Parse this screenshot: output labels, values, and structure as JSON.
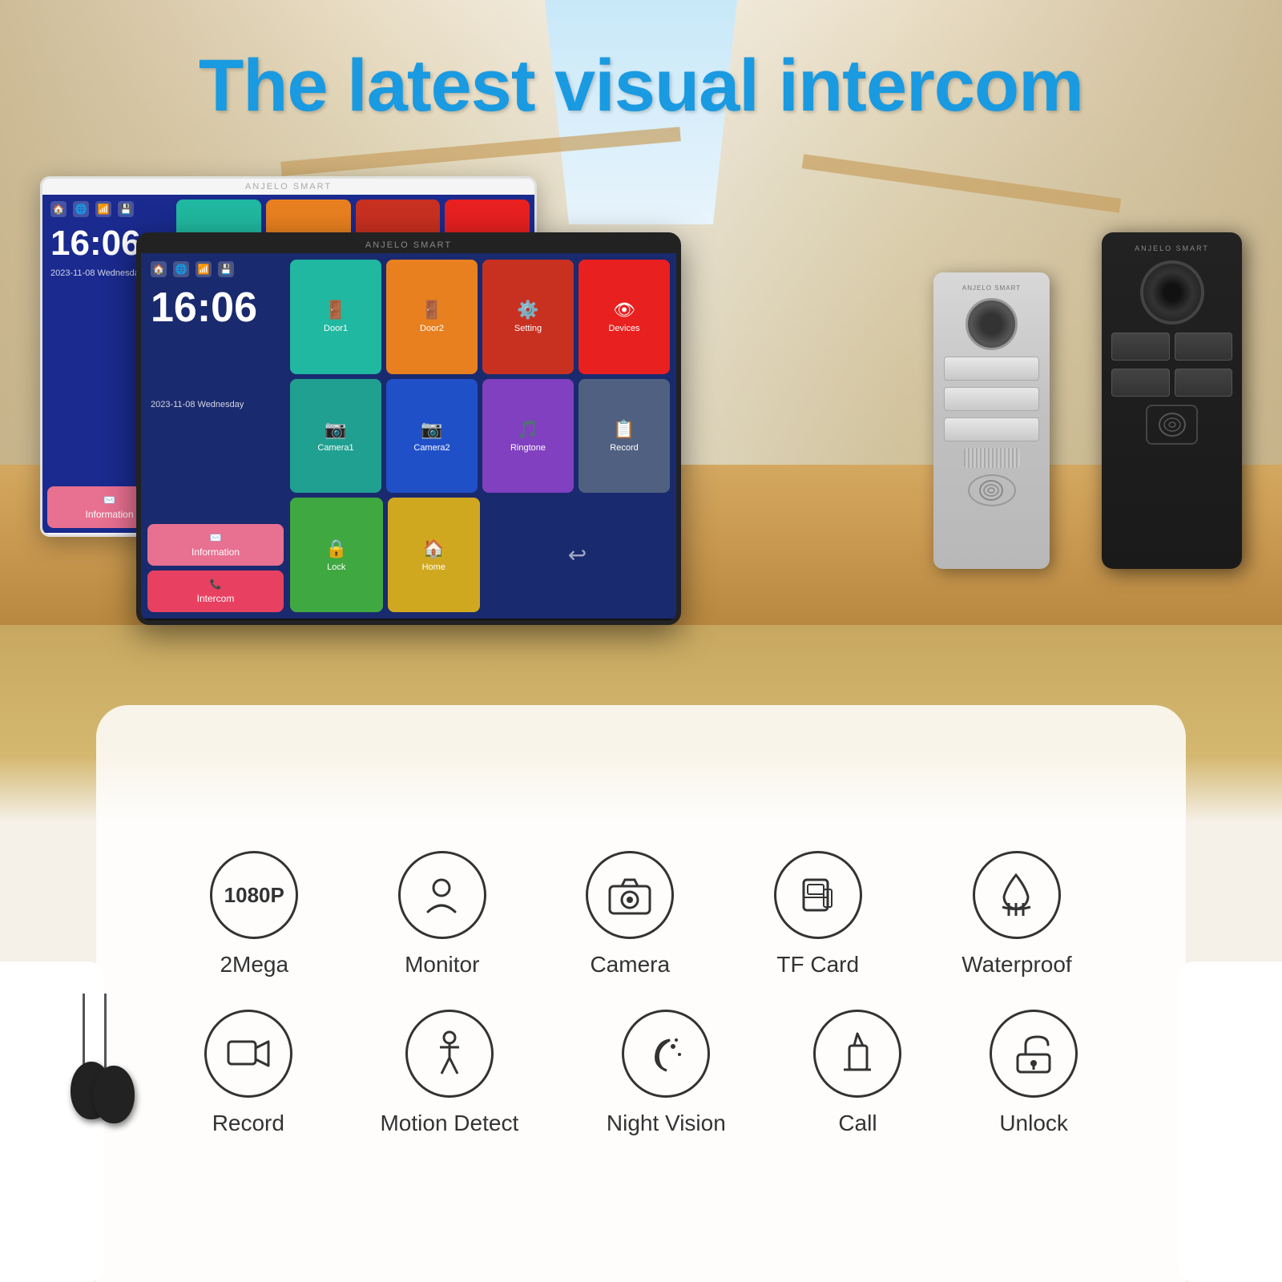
{
  "title": "The latest visual intercom",
  "monitor": {
    "brand": "ANJELO SMART",
    "clock": "16:06",
    "date": "2023-11-08 Wednesday",
    "tiles": [
      {
        "label": "Door1",
        "color": "teal",
        "icon": "🚪"
      },
      {
        "label": "Door2",
        "color": "orange",
        "icon": "🚪"
      },
      {
        "label": "Setting",
        "color": "red-dark",
        "icon": "⚙️"
      },
      {
        "label": "Devices",
        "color": "red-vivid",
        "icon": "👁"
      },
      {
        "label": "Camera1",
        "color": "teal2",
        "icon": "📷"
      },
      {
        "label": "Camera2",
        "color": "blue",
        "icon": "📷"
      },
      {
        "label": "Ringtone",
        "color": "purple",
        "icon": "🎵"
      },
      {
        "label": "Record",
        "color": "gray",
        "icon": "📋"
      },
      {
        "label": "Lock",
        "color": "green",
        "icon": "🔒"
      },
      {
        "label": "Home",
        "color": "yellow",
        "icon": "🏠"
      }
    ],
    "left_tiles": [
      {
        "label": "Information",
        "color": "pink",
        "icon": "✉️"
      },
      {
        "label": "Intercom",
        "color": "red",
        "icon": "📞"
      }
    ]
  },
  "features": {
    "row1": [
      {
        "icon": "1080P",
        "label": "2Mega",
        "type": "badge"
      },
      {
        "icon": "👤",
        "label": "Monitor",
        "type": "icon"
      },
      {
        "icon": "📷",
        "label": "Camera",
        "type": "icon"
      },
      {
        "icon": "🗂",
        "label": "TF Card",
        "type": "icon"
      },
      {
        "icon": "☂",
        "label": "Waterproof",
        "type": "icon"
      }
    ],
    "row2": [
      {
        "icon": "🎥",
        "label": "Record",
        "type": "icon"
      },
      {
        "icon": "🚶",
        "label": "Motion Detect",
        "type": "icon"
      },
      {
        "icon": "🌙",
        "label": "Night Vision",
        "type": "icon"
      },
      {
        "icon": "🔔",
        "label": "Call",
        "type": "icon"
      },
      {
        "icon": "🔑",
        "label": "Unlock",
        "type": "icon"
      }
    ]
  }
}
